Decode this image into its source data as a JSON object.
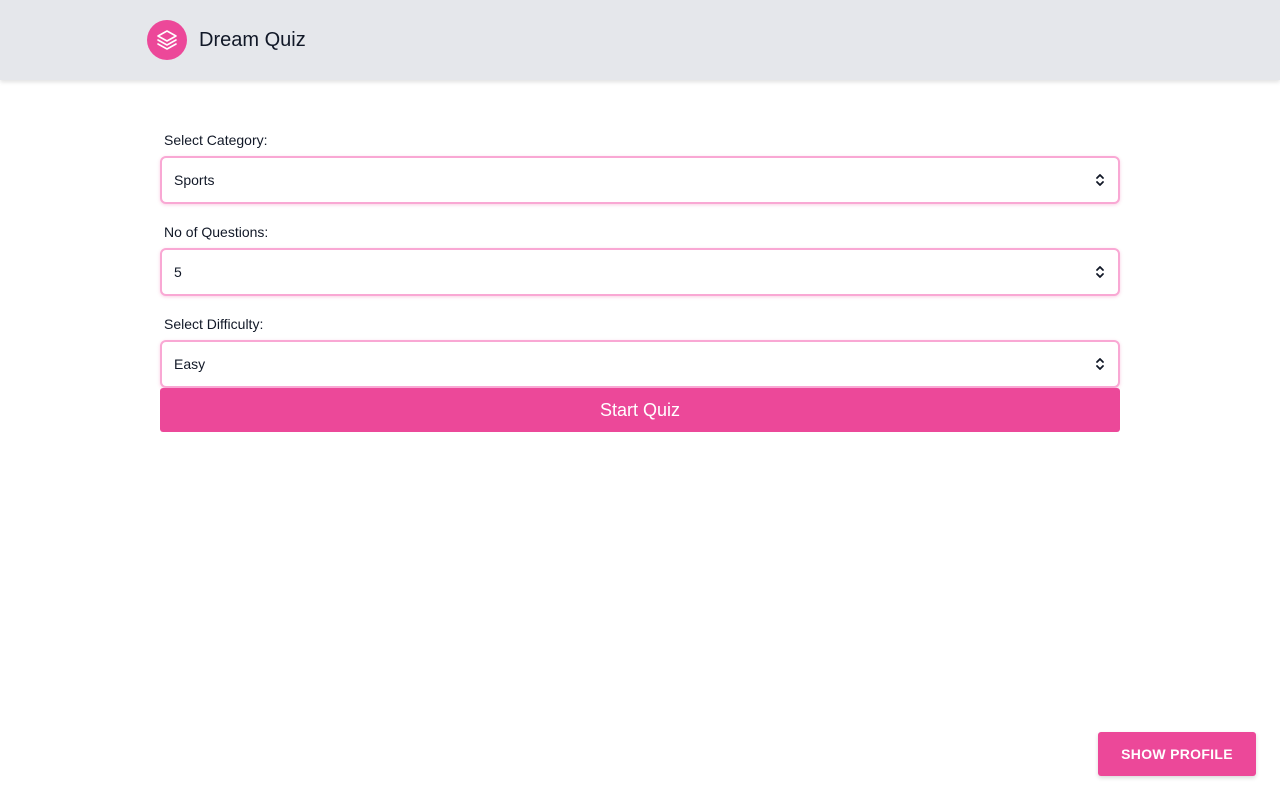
{
  "header": {
    "brand_name": "Dream Quiz",
    "logo_icon": "layers-icon"
  },
  "form": {
    "category": {
      "label": "Select Category:",
      "value": "Sports"
    },
    "questions": {
      "label": "No of Questions:",
      "value": "5"
    },
    "difficulty": {
      "label": "Select Difficulty:",
      "value": "Easy"
    },
    "start_label": "Start Quiz"
  },
  "footer": {
    "profile_label": "SHOW PROFILE"
  },
  "colors": {
    "accent": "#ec4899",
    "header_bg": "#e5e7eb",
    "select_border": "#f9a8d4"
  }
}
